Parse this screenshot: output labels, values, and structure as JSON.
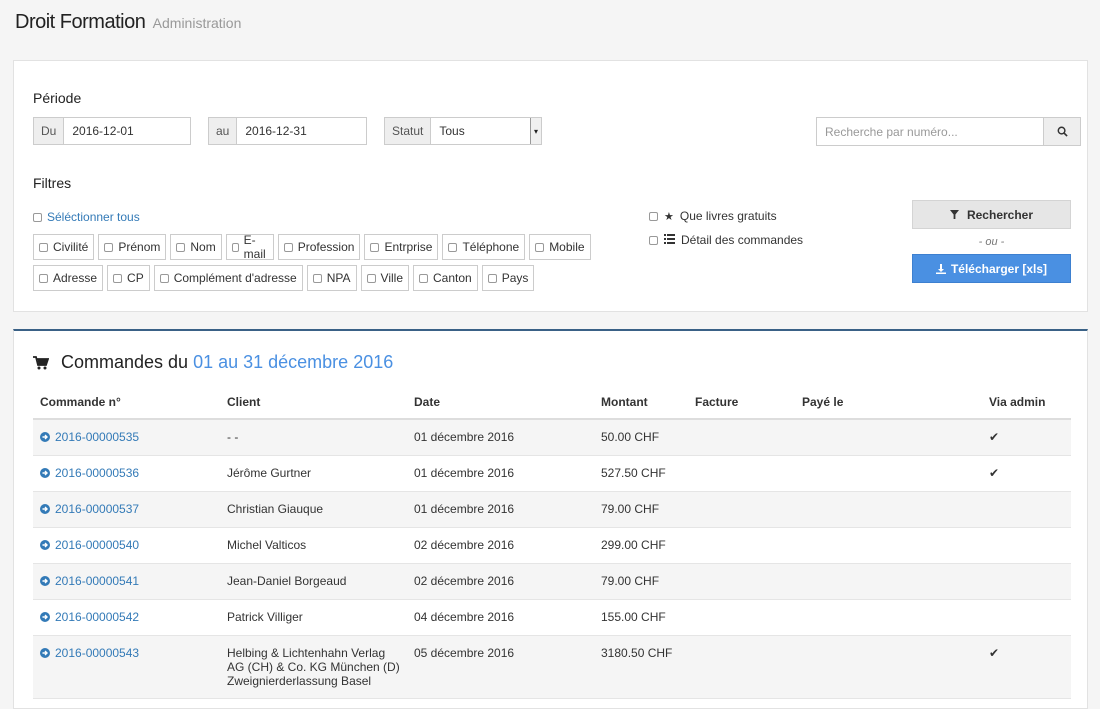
{
  "header": {
    "brand": "Droit Formation",
    "subtitle": "Administration"
  },
  "filter": {
    "periode_label": "Période",
    "du_label": "Du",
    "du_value": "2016-12-01",
    "au_label": "au",
    "au_value": "2016-12-31",
    "statut_label": "Statut",
    "statut_value": "Tous",
    "search_placeholder": "Recherche par numéro...",
    "filtres_label": "Filtres",
    "select_all": "Séléctionner tous",
    "fields_row1": [
      "Civilité",
      "Prénom",
      "Nom",
      "E-mail",
      "Profession",
      "Entrprise",
      "Téléphone",
      "Mobile"
    ],
    "fields_row2": [
      "Adresse",
      "CP",
      "Complément d'adresse",
      "NPA",
      "Ville",
      "Canton",
      "Pays"
    ],
    "option_free": "Que livres gratuits",
    "option_detail": "Détail des commandes",
    "btn_search": "Rechercher",
    "or": "- ou -",
    "btn_download": "Télécharger [xls]"
  },
  "orders": {
    "title": "Commandes du",
    "period": "01 au 31 décembre 2016",
    "columns": [
      "Commande n°",
      "Client",
      "Date",
      "Montant",
      "Facture",
      "Payé le",
      "Via admin"
    ],
    "rows": [
      {
        "number": "2016-00000535",
        "client": "- -",
        "date": "01 décembre 2016",
        "amount": "50.00 CHF",
        "facture": "",
        "paye": "",
        "via_admin": "✔"
      },
      {
        "number": "2016-00000536",
        "client": "Jérôme Gurtner",
        "date": "01 décembre 2016",
        "amount": "527.50 CHF",
        "facture": "",
        "paye": "",
        "via_admin": "✔"
      },
      {
        "number": "2016-00000537",
        "client": "Christian Giauque",
        "date": "01 décembre 2016",
        "amount": "79.00 CHF",
        "facture": "",
        "paye": "",
        "via_admin": ""
      },
      {
        "number": "2016-00000540",
        "client": "Michel Valticos",
        "date": "02 décembre 2016",
        "amount": "299.00 CHF",
        "facture": "",
        "paye": "",
        "via_admin": ""
      },
      {
        "number": "2016-00000541",
        "client": "Jean-Daniel Borgeaud",
        "date": "02 décembre 2016",
        "amount": "79.00 CHF",
        "facture": "",
        "paye": "",
        "via_admin": ""
      },
      {
        "number": "2016-00000542",
        "client": "Patrick Villiger",
        "date": "04 décembre 2016",
        "amount": "155.00 CHF",
        "facture": "",
        "paye": "",
        "via_admin": ""
      },
      {
        "number": "2016-00000543",
        "client": "Helbing & Lichtenhahn Verlag AG (CH) & Co. KG München (D) Zweignierderlassung Basel",
        "date": "05 décembre 2016",
        "amount": "3180.50 CHF",
        "facture": "",
        "paye": "",
        "via_admin": "✔"
      }
    ]
  },
  "colors": {
    "link": "#337ab7",
    "primary": "#4a90e2",
    "panel_top_border": "#3a6186"
  }
}
